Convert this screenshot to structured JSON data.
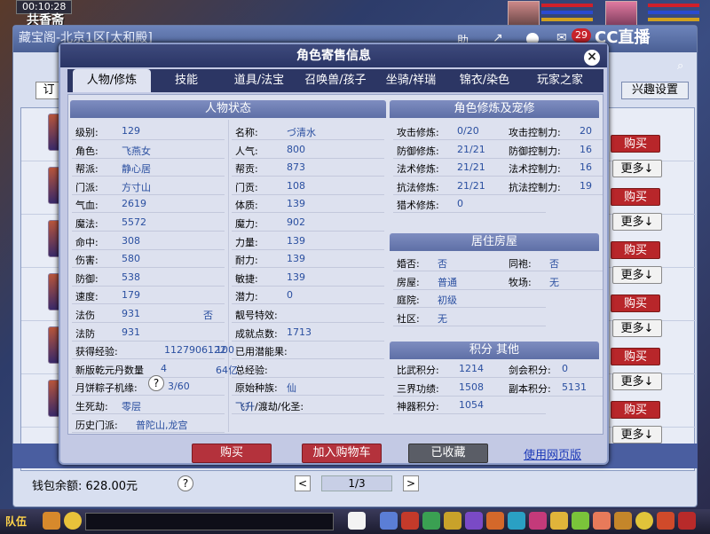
{
  "topbar": {
    "clock": "00:10:28",
    "location": "共香斋"
  },
  "under": {
    "title": "藏宝阁-北京1区[太和殿]",
    "filter_label": "订",
    "hobby_button": "兴趣设置",
    "buy_label": "购买",
    "more_label": "更多↓",
    "wallet": "钱包余额: 628.00元",
    "help": "?",
    "prev": "<",
    "next": ">",
    "page": "1/3",
    "badge": "29",
    "logo": "CC直播",
    "top_icons": [
      "助"
    ]
  },
  "modal": {
    "title": "角色寄售信息",
    "close": "×",
    "tabs": [
      "人物/修炼",
      "技能",
      "道具/法宝",
      "召唤兽/孩子",
      "坐骑/祥瑞",
      "锦衣/染色",
      "玩家之家"
    ],
    "status_head": "人物状态",
    "status_left": [
      {
        "k": "级别:",
        "v": "129"
      },
      {
        "k": "角色:",
        "v": "飞燕女"
      },
      {
        "k": "帮派:",
        "v": "静心居"
      },
      {
        "k": "门派:",
        "v": "方寸山"
      },
      {
        "k": "气血:",
        "v": "2619"
      },
      {
        "k": "魔法:",
        "v": "5572"
      },
      {
        "k": "命中:",
        "v": "308"
      },
      {
        "k": "伤害:",
        "v": "580"
      },
      {
        "k": "防御:",
        "v": "538"
      },
      {
        "k": "速度:",
        "v": "179"
      },
      {
        "k": "法伤",
        "v": "931"
      },
      {
        "k": "法防",
        "v": "931"
      },
      {
        "k": "获得经验:",
        "v": "1127906122"
      },
      {
        "k": "新版乾元丹数量",
        "v": "4"
      },
      {
        "k": "月饼粽子机缘:",
        "v": "3/60"
      },
      {
        "k": "生死劫:",
        "v": "零层"
      },
      {
        "k": "历史门派:",
        "v": "普陀山,龙宫"
      }
    ],
    "status_right": [
      {
        "k": "名称:",
        "v": "づ清水"
      },
      {
        "k": "人气:",
        "v": "800"
      },
      {
        "k": "帮贡:",
        "v": "873"
      },
      {
        "k": "门贡:",
        "v": "108"
      },
      {
        "k": "体质:",
        "v": "139"
      },
      {
        "k": "魔力:",
        "v": "902"
      },
      {
        "k": "力量:",
        "v": "139"
      },
      {
        "k": "耐力:",
        "v": "139"
      },
      {
        "k": "敏捷:",
        "v": "139"
      },
      {
        "k": "潜力:",
        "v": "0"
      },
      {
        "k": "靓号特效:",
        "v": "否"
      },
      {
        "k": "成就点数:",
        "v": "1713"
      },
      {
        "k": "已用潜能果:",
        "v": "100"
      },
      {
        "k": "总经验:",
        "v": "64亿"
      },
      {
        "k": "原始种族:",
        "v": "仙"
      },
      {
        "k": "飞升/渡劫/化圣:",
        "v": "飞升"
      }
    ],
    "train_head": "角色修炼及宠修",
    "train_left": [
      {
        "k": "攻击修炼:",
        "v": "0/20"
      },
      {
        "k": "防御修炼:",
        "v": "21/21"
      },
      {
        "k": "法术修炼:",
        "v": "21/21"
      },
      {
        "k": "抗法修炼:",
        "v": "21/21"
      },
      {
        "k": "猎术修炼:",
        "v": "0"
      }
    ],
    "train_right": [
      {
        "k": "攻击控制力:",
        "v": "20"
      },
      {
        "k": "防御控制力:",
        "v": "16"
      },
      {
        "k": "法术控制力:",
        "v": "16"
      },
      {
        "k": "抗法控制力:",
        "v": "19"
      }
    ],
    "house_head": "居住房屋",
    "house_left": [
      {
        "k": "婚否:",
        "v": "否"
      },
      {
        "k": "房屋:",
        "v": "普通"
      },
      {
        "k": "庭院:",
        "v": "初级"
      },
      {
        "k": "社区:",
        "v": "无"
      }
    ],
    "house_right": [
      {
        "k": "同袍:",
        "v": "否"
      },
      {
        "k": "牧场:",
        "v": "无"
      }
    ],
    "score_head": "积分 其他",
    "score_left": [
      {
        "k": "比武积分:",
        "v": "1214"
      },
      {
        "k": "三界功绩:",
        "v": "1508"
      },
      {
        "k": "神器积分:",
        "v": "1054"
      }
    ],
    "score_right": [
      {
        "k": "剑会积分:",
        "v": "0"
      },
      {
        "k": "副本积分:",
        "v": "5131"
      }
    ],
    "q_icon": "?",
    "buttons": {
      "buy": "购买",
      "cart": "加入购物车",
      "fav": "已收藏",
      "web": "使用网页版"
    }
  },
  "taskbar": {
    "team": "队伍"
  }
}
